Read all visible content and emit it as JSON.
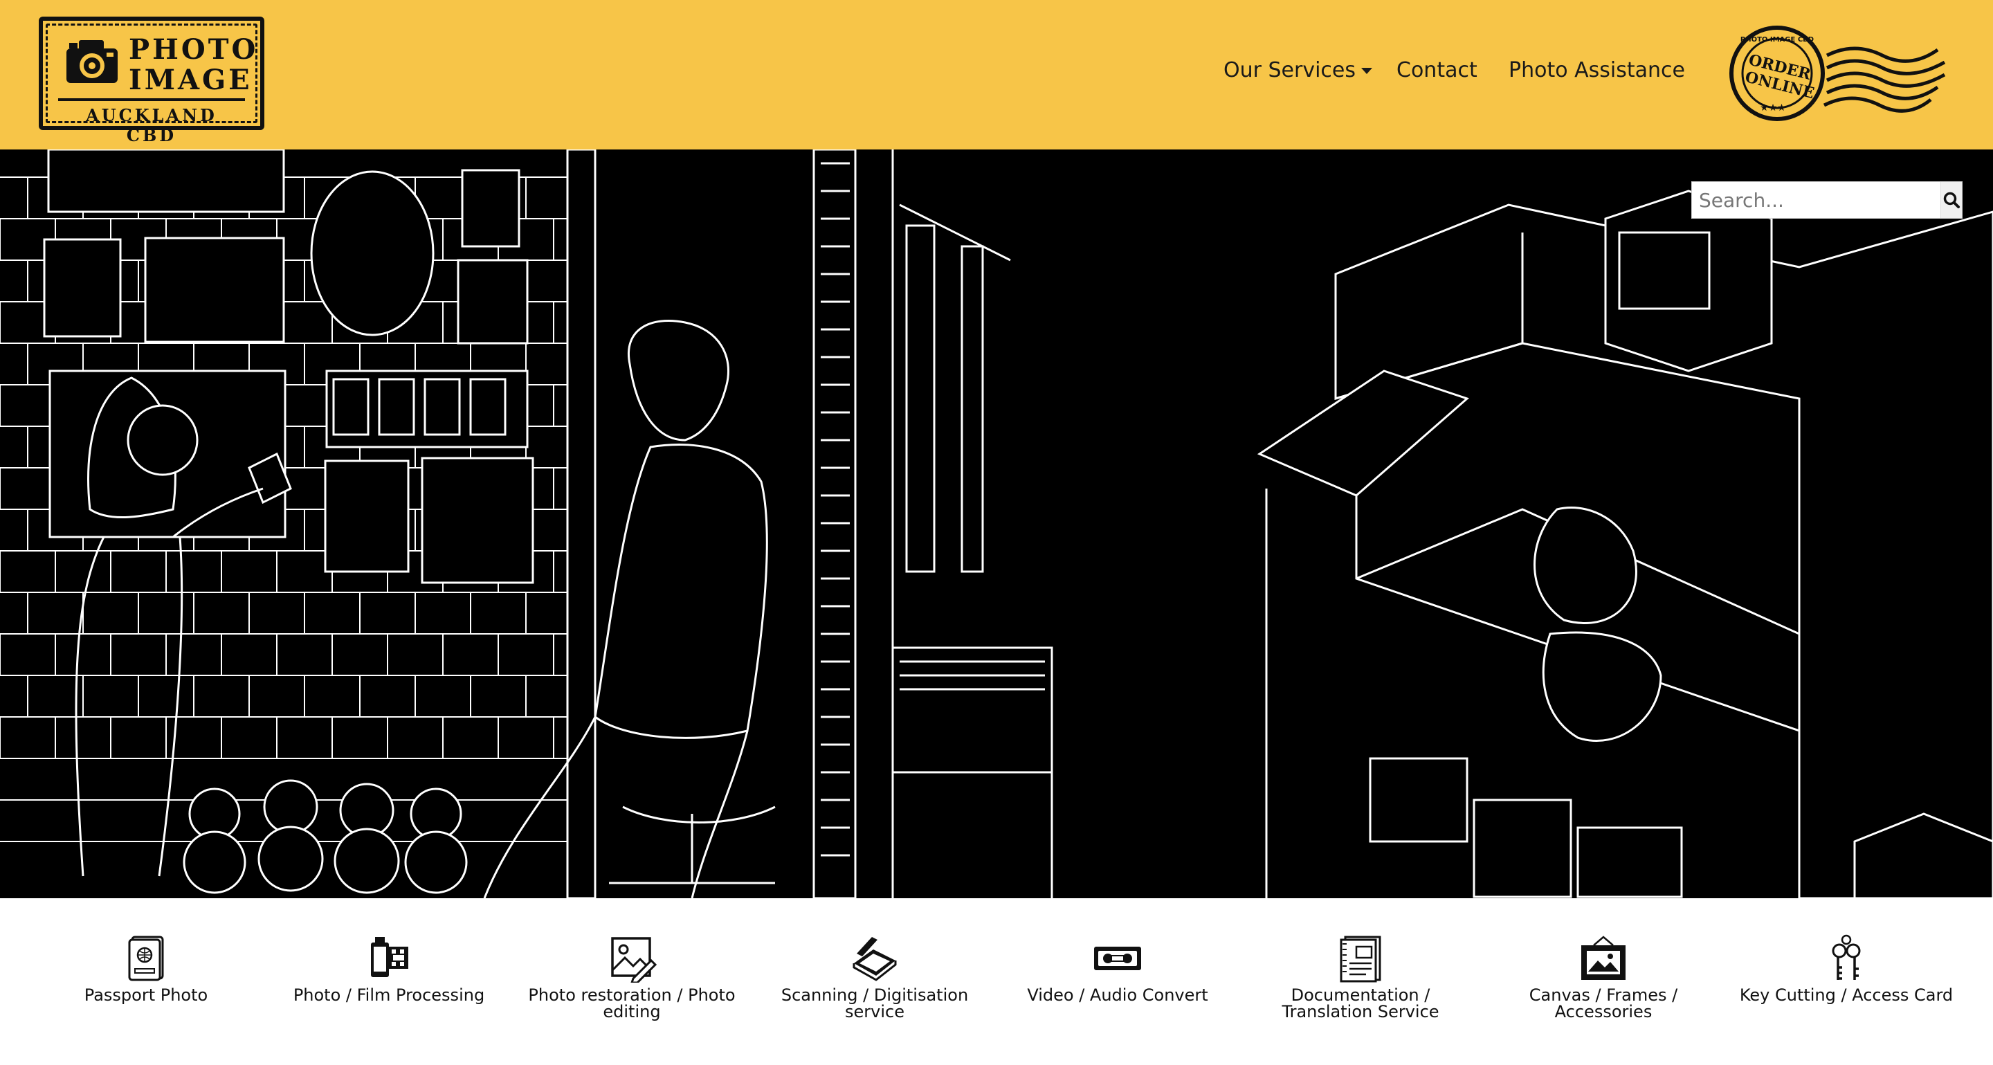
{
  "header": {
    "logo": {
      "line1": "PHOTO",
      "line2": "IMAGE",
      "line3": "AUCKLAND CBD"
    },
    "nav": [
      {
        "label": "Our Services"
      },
      {
        "label": "Contact"
      },
      {
        "label": "Photo Assistance"
      }
    ],
    "stamp": {
      "ring_text": "PHOTO IMAGE CBD",
      "line1": "ORDER",
      "line2": "ONLINE"
    },
    "background_color": "#f7c548"
  },
  "hero": {
    "background_color": "#000000",
    "line_color": "#ffffff"
  },
  "search": {
    "placeholder": "Search...",
    "icon": "search-icon"
  },
  "services": [
    {
      "label": "Passport Photo",
      "icon": "passport-icon"
    },
    {
      "label": "Photo / Film Processing",
      "icon": "film-roll-icon"
    },
    {
      "label": "Photo restoration / Photo editing",
      "icon": "photo-edit-icon"
    },
    {
      "label": "Scanning / Digitisation service",
      "icon": "scanner-icon"
    },
    {
      "label": "Video / Audio Convert",
      "icon": "vhs-tape-icon"
    },
    {
      "label": "Documentation / Translation Service",
      "icon": "document-icon"
    },
    {
      "label": "Canvas / Frames / Accessories",
      "icon": "picture-frame-icon"
    },
    {
      "label": "Key Cutting / Access Card",
      "icon": "keys-icon"
    }
  ]
}
